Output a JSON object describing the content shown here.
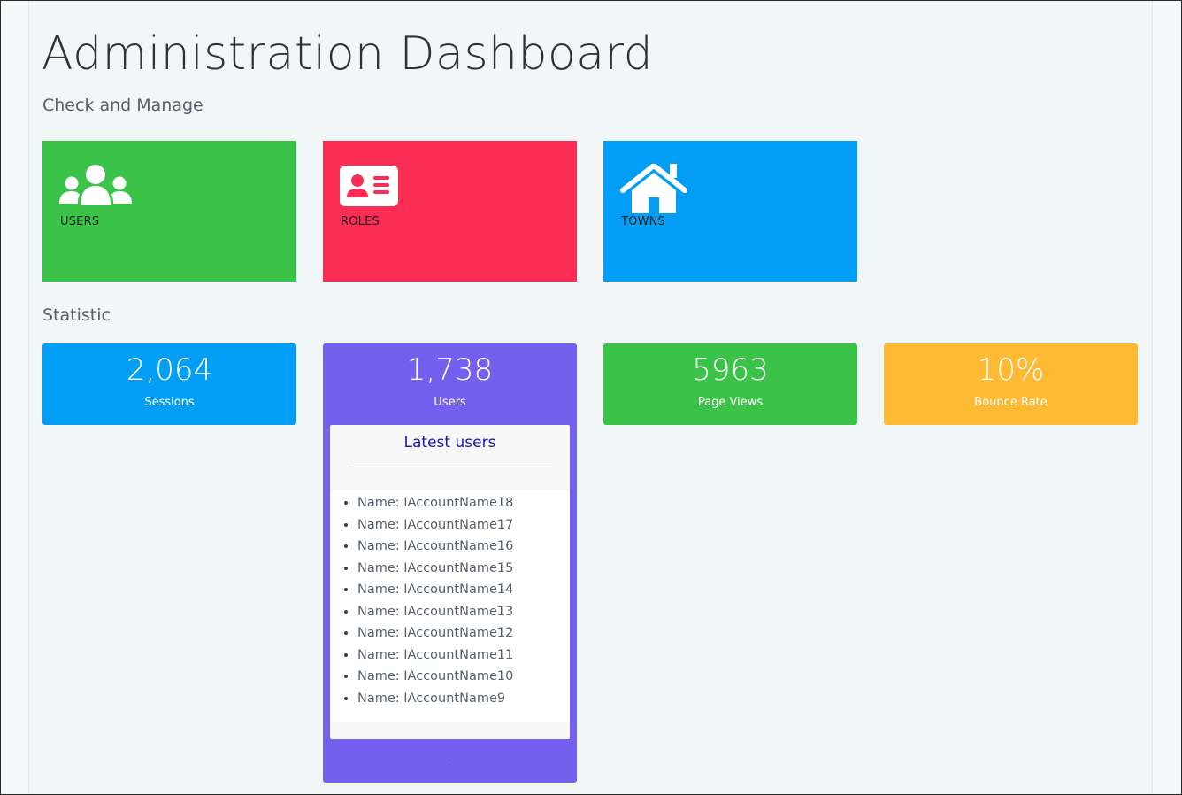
{
  "page": {
    "title": "Administration Dashboard",
    "subtitle": "Check and Manage",
    "statistic_label": "Statistic"
  },
  "tiles": [
    {
      "label": "USERS",
      "icon": "users-icon",
      "color": "#3bc248"
    },
    {
      "label": "ROLES",
      "icon": "id-card-icon",
      "color": "#fa2d55"
    },
    {
      "label": "TOWNS",
      "icon": "home-icon",
      "color": "#029ef6"
    }
  ],
  "stats": [
    {
      "value": "2,064",
      "label": "Sessions",
      "color": "#029ef6"
    },
    {
      "value": "1,738",
      "label": "Users",
      "color": "#745fef"
    },
    {
      "value": "5963",
      "label": "Page Views",
      "color": "#3bc248"
    },
    {
      "value": "10%",
      "label": "Bounce Rate",
      "color": "#fdba32"
    }
  ],
  "latest_users": {
    "title": "Latest users",
    "items": [
      "Name: IAccountName18",
      "Name: IAccountName17",
      "Name: IAccountName16",
      "Name: IAccountName15",
      "Name: IAccountName14",
      "Name: IAccountName13",
      "Name: IAccountName12",
      "Name: IAccountName11",
      "Name: IAccountName10",
      "Name: IAccountName9"
    ]
  }
}
